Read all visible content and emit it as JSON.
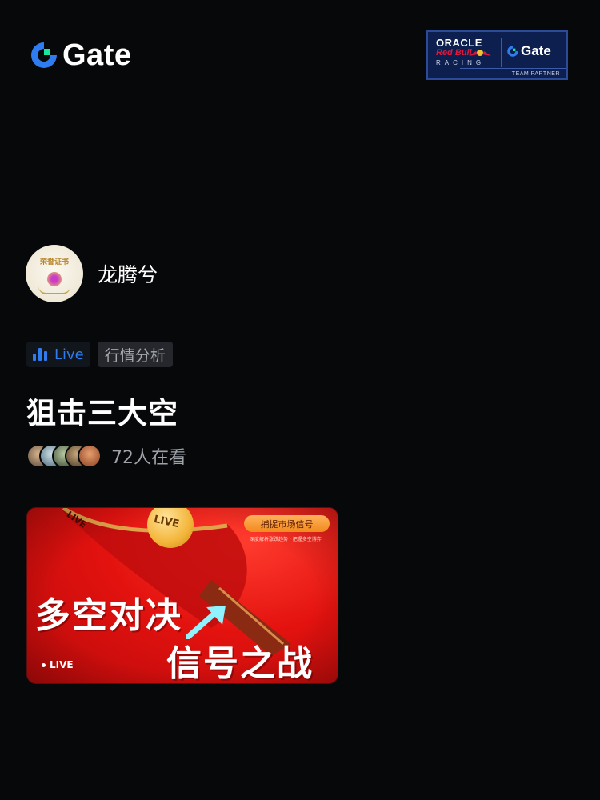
{
  "header": {
    "brand_name": "Gate",
    "partner": {
      "oracle": "ORACLE",
      "redbull": "Red Bull",
      "racing": "RACING",
      "gate": "Gate",
      "team_partner": "TEAM PARTNER"
    }
  },
  "host": {
    "avatar_text": "荣誉证书",
    "name": "龙腾兮"
  },
  "tags": {
    "live_label": "Live",
    "category": "行情分析"
  },
  "stream": {
    "title": "狙击三大空",
    "viewer_count_text": "72人在看"
  },
  "banner": {
    "pill_text": "捕捉市场信号",
    "sub_text": "深度解析涨跌趋势 · 把握多空博弈",
    "headline_1": "多空对决",
    "headline_2": "信号之战",
    "live_badge": "LIVE",
    "ball_text": "LIVE",
    "rim_text": "LIVE"
  },
  "colors": {
    "background": "#07080a",
    "accent_blue": "#2f7bf0",
    "brand_green": "#17e6a1",
    "banner_red": "#e3120f"
  }
}
